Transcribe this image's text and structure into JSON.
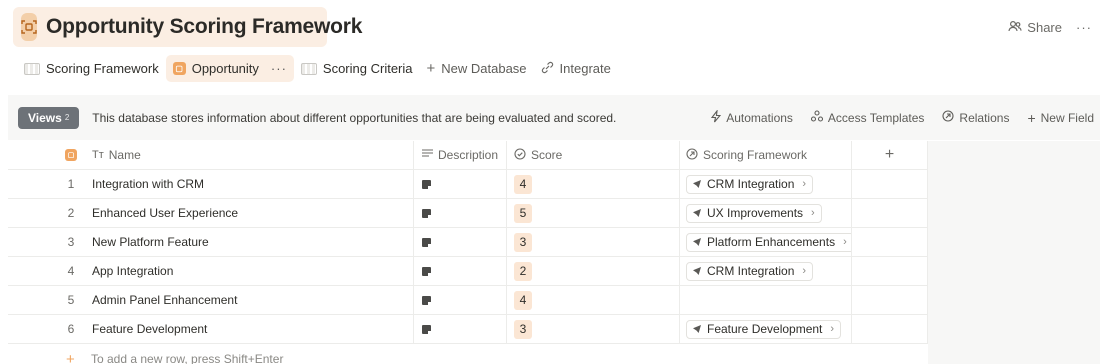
{
  "header": {
    "title": "Opportunity Scoring Framework",
    "share_label": "Share",
    "more_label": "···"
  },
  "tabs": [
    {
      "label": "Scoring Framework",
      "active": false,
      "icon": "table-icon"
    },
    {
      "label": "Opportunity",
      "active": true,
      "icon": "orange-database-icon",
      "more": "···"
    },
    {
      "label": "Scoring Criteria",
      "active": false,
      "icon": "table-icon"
    },
    {
      "label": "New Database",
      "active": false,
      "icon": "plus-icon"
    },
    {
      "label": "Integrate",
      "active": false,
      "icon": "integrate-icon"
    }
  ],
  "infobar": {
    "views_label": "Views",
    "views_count": "2",
    "description": "This database stores information about different opportunities that are being evaluated and scored.",
    "actions": [
      "Automations",
      "Access Templates",
      "Relations",
      "New Field"
    ]
  },
  "table": {
    "headers": {
      "name": "Name",
      "description": "Description",
      "score": "Score",
      "framework": "Scoring Framework"
    },
    "rows": [
      {
        "num": "1",
        "name": "Integration with CRM",
        "score": "4",
        "framework": "CRM Integration"
      },
      {
        "num": "2",
        "name": "Enhanced User Experience",
        "score": "5",
        "framework": "UX Improvements"
      },
      {
        "num": "3",
        "name": "New Platform Feature",
        "score": "3",
        "framework": "Platform Enhancements"
      },
      {
        "num": "4",
        "name": "App Integration",
        "score": "2",
        "framework": "CRM Integration"
      },
      {
        "num": "5",
        "name": "Admin Panel Enhancement",
        "score": "4",
        "framework": ""
      },
      {
        "num": "6",
        "name": "Feature Development",
        "score": "3",
        "framework": "Feature Development"
      }
    ],
    "new_row_hint": "To add a new row, press Shift+Enter"
  },
  "colors": {
    "accent": "#f0a560",
    "accent_light": "#fbeee3",
    "score_bg": "#fbe6d4",
    "views_bg": "#6d7278"
  }
}
